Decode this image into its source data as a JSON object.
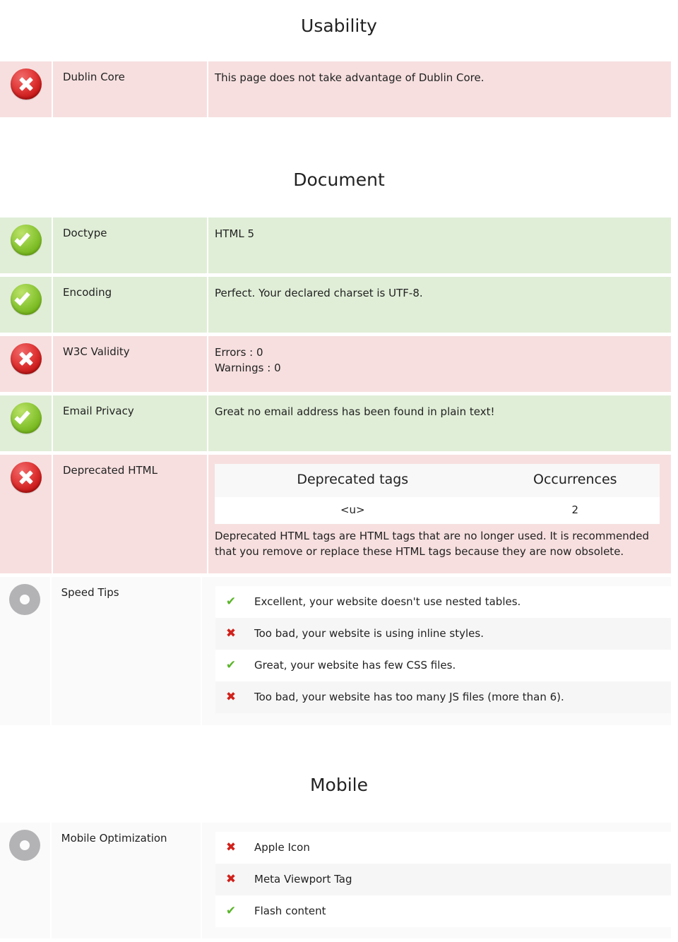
{
  "sections": [
    {
      "id": "usability",
      "title": "Usability",
      "rows": [
        {
          "status": "bad",
          "icon": "red-cross-badge-icon",
          "label": "Dublin Core",
          "content": "This page does not take advantage of Dublin Core."
        }
      ]
    },
    {
      "id": "document",
      "title": "Document",
      "rows": [
        {
          "status": "good",
          "icon": "green-check-badge-icon",
          "label": "Doctype",
          "content": "HTML 5"
        },
        {
          "status": "good",
          "icon": "green-check-badge-icon",
          "label": "Encoding",
          "content": "Perfect. Your declared charset is UTF-8."
        },
        {
          "status": "bad",
          "icon": "red-cross-badge-icon",
          "label": "W3C Validity",
          "line1": "Errors : 0",
          "line2": "Warnings : 0"
        },
        {
          "status": "good",
          "icon": "green-check-badge-icon",
          "label": "Email Privacy",
          "content": "Great no email address has been found in plain text!"
        },
        {
          "status": "bad",
          "icon": "red-cross-badge-icon",
          "label": "Deprecated HTML",
          "table": {
            "headers": [
              "Deprecated tags",
              "Occurrences"
            ],
            "rows": [
              [
                "<u>",
                "2"
              ]
            ]
          },
          "note": "Deprecated HTML tags are HTML tags that are no longer used. It is recommended that you remove or replace these HTML tags because they are now obsolete."
        },
        {
          "status": "neutral",
          "icon": "gray-donut-badge-icon",
          "label": "Speed Tips",
          "tips": [
            {
              "result": "ok",
              "icon": "green-check-icon",
              "glyph": "✔",
              "text": "Excellent, your website doesn't use nested tables."
            },
            {
              "result": "no",
              "icon": "red-cross-icon",
              "glyph": "✖",
              "text": "Too bad, your website is using inline styles."
            },
            {
              "result": "ok",
              "icon": "green-check-icon",
              "glyph": "✔",
              "text": "Great, your website has few CSS files."
            },
            {
              "result": "no",
              "icon": "red-cross-icon",
              "glyph": "✖",
              "text": "Too bad, your website has too many JS files (more than 6)."
            }
          ]
        }
      ]
    },
    {
      "id": "mobile",
      "title": "Mobile",
      "rows": [
        {
          "status": "neutral",
          "icon": "gray-donut-badge-icon",
          "label": "Mobile Optimization",
          "tips": [
            {
              "result": "no",
              "icon": "red-cross-icon",
              "glyph": "✖",
              "text": "Apple Icon"
            },
            {
              "result": "no",
              "icon": "red-cross-icon",
              "glyph": "✖",
              "text": "Meta Viewport Tag"
            },
            {
              "result": "ok",
              "icon": "green-check-icon",
              "glyph": "✔",
              "text": "Flash content"
            }
          ]
        }
      ]
    }
  ],
  "colors": {
    "bad_bg": "#f7dfdf",
    "good_bg": "#e0eed7",
    "neutral_bg": "#fafafa",
    "check_green": "#5bb52a",
    "cross_red": "#d1211b",
    "text": "#222222"
  }
}
